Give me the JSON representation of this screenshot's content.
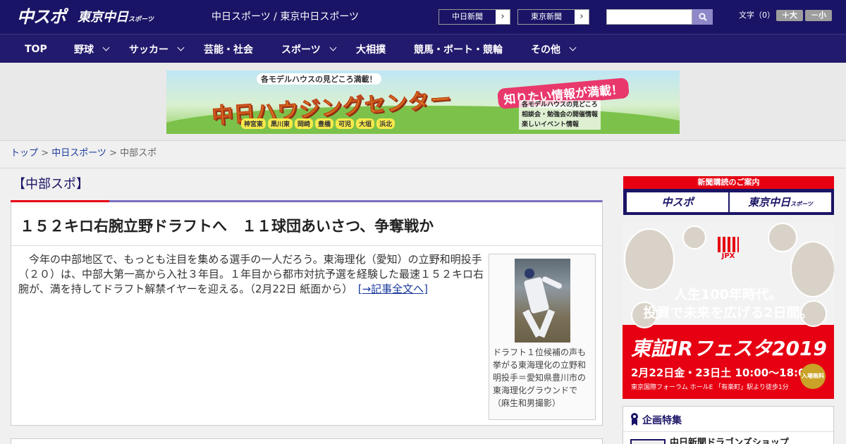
{
  "header": {
    "logo_chuspo": "中スポ",
    "logo_tokyo": "東京中日",
    "logo_tokyo_sub": "スポーツ",
    "site_title": "中日スポーツ / 東京中日スポーツ",
    "chunichi_link": "中日新聞",
    "tokyo_link": "東京新聞",
    "search_placeholder": "",
    "text_size_label": "文字（0）",
    "size_up": "＋大",
    "size_down": "－小"
  },
  "nav": {
    "items": [
      {
        "label": "TOP",
        "has_menu": false
      },
      {
        "label": "野球",
        "has_menu": true
      },
      {
        "label": "サッカー",
        "has_menu": true
      },
      {
        "label": "芸能・社会",
        "has_menu": false
      },
      {
        "label": "スポーツ",
        "has_menu": true
      },
      {
        "label": "大相撲",
        "has_menu": false
      },
      {
        "label": "競馬・ボート・競輪",
        "has_menu": false
      },
      {
        "label": "その他",
        "has_menu": true
      }
    ]
  },
  "banner_ad": {
    "kicker": "各モデルハウスの見どころ満載！",
    "title": "中日ハウジングセンター",
    "slogan": "知りたい情報が満載！",
    "towns": [
      "神宮東",
      "黒川東",
      "岡崎",
      "豊橋",
      "可児",
      "大垣",
      "浜北"
    ],
    "features": [
      "各モデルハウスの見どころ",
      "相談会・勉強会の開催情報",
      "楽しいイベント情報"
    ]
  },
  "breadcrumb": {
    "top": "トップ",
    "chunichi_sports": "中日スポーツ",
    "current": "中部スポ",
    "sep": " > "
  },
  "section": {
    "title": "【中部スポ】"
  },
  "article": {
    "headline": "１５２キロ右腕立野ドラフトへ　１１球団あいさつ、争奪戦か",
    "body": "　今年の中部地区で、もっとも注目を集める選手の一人だろう。東海理化（愛知）の立野和明投手（２０）は、中部大第一高から入社３年目。１年目から都市対抗予選を経験した最速１５２キロ右腕が、満を持してドラフト解禁イヤーを迎える。（2月22日 紙面から）　",
    "read_more": "[→記事全文へ]",
    "caption": "ドラフト１位候補の声も挙がる東海理化の立野和明投手＝愛知県豊川市の東海理化グラウンドで（麻生和男撮影）"
  },
  "sidebar": {
    "subscribe_label": "新聞購読のご案内",
    "subscribe_chuspo": "中スポ",
    "subscribe_tokyo": "東京中日",
    "subscribe_tokyo_sub": "スポーツ",
    "jpx_ad": {
      "brand": "JPX",
      "line1": "人生100年時代。",
      "line2": "投資で未来を広げる2日間。",
      "title": "東証IRフェスタ2019",
      "dates": "2月22日金・23日土 10:00～18:00",
      "venue": "東京国際フォーラム ホールE 「有楽町」駅より徒歩1分",
      "free": "入場無料"
    },
    "feature": {
      "title": "企画特集",
      "item": "中日新聞ドラゴンズショップ"
    }
  },
  "colors": {
    "header_bg": "#1a1466",
    "nav_bg": "#221a6d",
    "accent_red": "#e60012",
    "link_blue": "#1a3a9c"
  }
}
